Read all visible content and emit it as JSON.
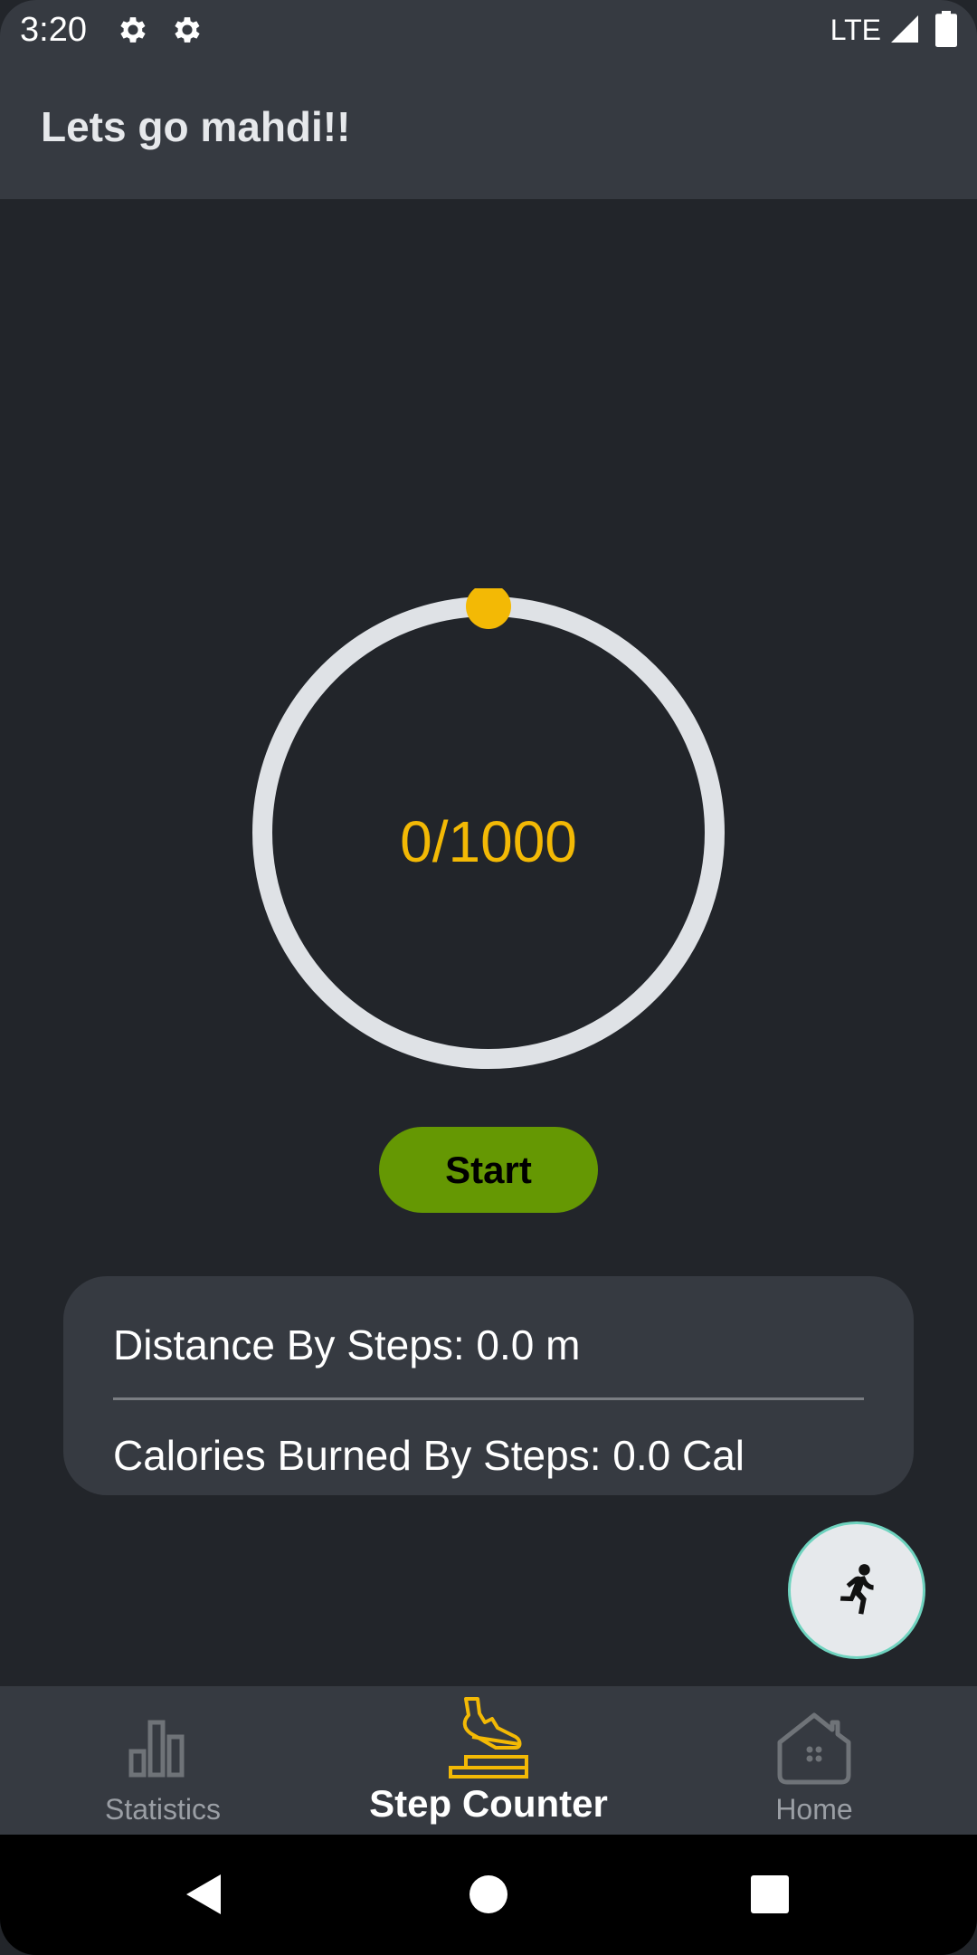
{
  "status_bar": {
    "time": "3:20",
    "network": "LTE",
    "icons": [
      "gear-icon",
      "gear-icon",
      "signal-icon",
      "battery-icon"
    ]
  },
  "app_bar": {
    "title": "Lets go mahdi!!"
  },
  "progress": {
    "text": "0/1000",
    "current": 0,
    "goal": 1000,
    "track_color": "#dfe2e6",
    "indicator_color": "#f3b905"
  },
  "start_button": {
    "label": "Start",
    "color": "#659803"
  },
  "info_card": {
    "distance": "Distance By Steps: 0.0 m",
    "calories": "Calories Burned By Steps: 0.0 Cal"
  },
  "fab": {
    "icon": "running-person-icon"
  },
  "bottom_nav": {
    "items": [
      {
        "label": "Statistics",
        "icon": "bar-chart-icon",
        "active": false
      },
      {
        "label": "Step Counter",
        "icon": "sneaker-step-icon",
        "active": true
      },
      {
        "label": "Home",
        "icon": "home-icon",
        "active": false
      }
    ],
    "active_color": "#f3b905",
    "inactive_color": "#6f7378"
  },
  "system_nav": {
    "icons": [
      "back-icon",
      "home-circle-icon",
      "recents-icon"
    ]
  },
  "colors": {
    "background": "#22252a",
    "surface": "#363a41",
    "accent": "#f3b905"
  }
}
